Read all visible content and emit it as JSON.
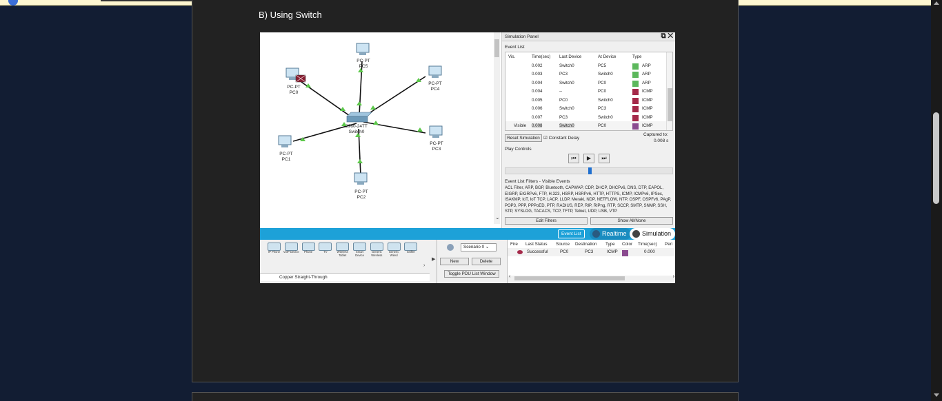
{
  "banner": {},
  "article": {
    "heading": "B) Using Switch"
  },
  "topology": {
    "devices": [
      {
        "id": "pc0",
        "type": "PC-PT",
        "name": "PC0"
      },
      {
        "id": "pc1",
        "type": "PC-PT",
        "name": "PC1"
      },
      {
        "id": "pc2",
        "type": "PC-PT",
        "name": "PC2"
      },
      {
        "id": "pc3",
        "type": "PC-PT",
        "name": "PC3"
      },
      {
        "id": "pc4",
        "type": "PC-PT",
        "name": "PC4"
      },
      {
        "id": "pc5",
        "type": "PC-PT",
        "name": "PC5"
      },
      {
        "id": "switch0",
        "type": "2960-24TT",
        "name": "Switch0"
      }
    ]
  },
  "sim_panel": {
    "title": "Simulation Panel",
    "event_list_label": "Event List",
    "columns": [
      "Vis.",
      "Time(sec)",
      "Last Device",
      "At Device",
      "Type"
    ],
    "events": [
      {
        "vis": "",
        "time": "0.002",
        "last": "Switch0",
        "at": "PC5",
        "type": "ARP",
        "color": "#5cb85c"
      },
      {
        "vis": "",
        "time": "0.003",
        "last": "PC3",
        "at": "Switch0",
        "type": "ARP",
        "color": "#5cb85c"
      },
      {
        "vis": "",
        "time": "0.004",
        "last": "Switch0",
        "at": "PC0",
        "type": "ARP",
        "color": "#5cb85c"
      },
      {
        "vis": "",
        "time": "0.004",
        "last": "--",
        "at": "PC0",
        "type": "ICMP",
        "color": "#a52a4a"
      },
      {
        "vis": "",
        "time": "0.005",
        "last": "PC0",
        "at": "Switch0",
        "type": "ICMP",
        "color": "#a52a4a"
      },
      {
        "vis": "",
        "time": "0.006",
        "last": "Switch0",
        "at": "PC3",
        "type": "ICMP",
        "color": "#a52a4a"
      },
      {
        "vis": "",
        "time": "0.007",
        "last": "PC3",
        "at": "Switch0",
        "type": "ICMP",
        "color": "#a52a4a"
      },
      {
        "vis": "Visible",
        "time": "0.008",
        "last": "Switch0",
        "at": "PC0",
        "type": "ICMP",
        "color": "#8a4a8f"
      }
    ],
    "reset_label": "Reset Simulation",
    "constant_delay_label": "Constant Delay",
    "captured_label": "Captured to:",
    "captured_value": "0.008 s",
    "play_controls_label": "Play Controls",
    "filters_label": "Event List Filters - Visible Events",
    "filters_text": "ACL Filter, ARP, BGP, Bluetooth, CAPWAP, CDP, DHCP, DHCPv6, DNS, DTP, EAPOL, EIGRP, EIGRPv6, FTP, H.323, HSRP, HSRPv6, HTTP, HTTPS, ICMP, ICMPv6, IPSec, ISAKMP, IoT, IoT TCP, LACP, LLDP, Meraki, NDP, NETFLOW, NTP, OSPF, OSPFv6, PAgP, POP3, PPP, PPPoED, PTP, RADIUS, REP, RIP, RIPng, RTP, SCCP, SMTP, SNMP, SSH, STP, SYSLOG, TACACS, TCP, TFTP, Telnet, UDP, USB, VTP",
    "edit_filters_label": "Edit Filters",
    "show_all_label": "Show All/None"
  },
  "mode_bar": {
    "event_list": "Event List",
    "realtime": "Realtime",
    "simulation": "Simulation"
  },
  "device_bar": {
    "items": [
      "IP Phone",
      "VoIP Device",
      "Phone",
      "TV",
      "Wireless Tablet",
      "Smart Device",
      "Generic Wireless",
      "Generic Wired",
      "Sniffer"
    ],
    "cable": "Copper Straight-Through"
  },
  "scenario": {
    "selected": "Scenario 0",
    "new_label": "New",
    "delete_label": "Delete",
    "toggle_label": "Toggle PDU List Window"
  },
  "pdu_list": {
    "columns": [
      "Fire",
      "Last Status",
      "Source",
      "Destination",
      "Type",
      "Color",
      "Time(sec)",
      "Peri"
    ],
    "rows": [
      {
        "status": "Successful",
        "source": "PC0",
        "destination": "PC3",
        "type": "ICMP",
        "color": "#8a4a8f",
        "time": "0.000"
      }
    ]
  }
}
